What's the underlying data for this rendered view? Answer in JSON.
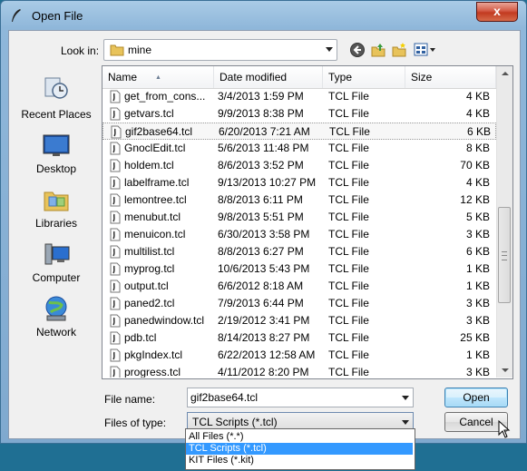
{
  "window": {
    "title": "Open File",
    "close_label": "x"
  },
  "toolbar": {
    "look_in_label": "Look in:",
    "look_in_value": "mine"
  },
  "places": [
    {
      "label": "Recent Places",
      "icon": "recent-places-icon"
    },
    {
      "label": "Desktop",
      "icon": "desktop-icon"
    },
    {
      "label": "Libraries",
      "icon": "libraries-icon"
    },
    {
      "label": "Computer",
      "icon": "computer-icon"
    },
    {
      "label": "Network",
      "icon": "network-icon"
    }
  ],
  "columns": {
    "name": "Name",
    "date": "Date modified",
    "type": "Type",
    "size": "Size"
  },
  "files": [
    {
      "name": "get_from_cons...",
      "date": "3/4/2013 1:59 PM",
      "type": "TCL File",
      "size": "4 KB"
    },
    {
      "name": "getvars.tcl",
      "date": "9/9/2013 8:38 PM",
      "type": "TCL File",
      "size": "4 KB"
    },
    {
      "name": "gif2base64.tcl",
      "date": "6/20/2013 7:21 AM",
      "type": "TCL File",
      "size": "6 KB",
      "selected": true
    },
    {
      "name": "GnoclEdit.tcl",
      "date": "5/6/2013 11:48 PM",
      "type": "TCL File",
      "size": "8 KB"
    },
    {
      "name": "holdem.tcl",
      "date": "8/6/2013 3:52 PM",
      "type": "TCL File",
      "size": "70 KB"
    },
    {
      "name": "labelframe.tcl",
      "date": "9/13/2013 10:27 PM",
      "type": "TCL File",
      "size": "4 KB"
    },
    {
      "name": "lemontree.tcl",
      "date": "8/8/2013 6:11 PM",
      "type": "TCL File",
      "size": "12 KB"
    },
    {
      "name": "menubut.tcl",
      "date": "9/8/2013 5:51 PM",
      "type": "TCL File",
      "size": "5 KB"
    },
    {
      "name": "menuicon.tcl",
      "date": "6/30/2013 3:58 PM",
      "type": "TCL File",
      "size": "3 KB"
    },
    {
      "name": "multilist.tcl",
      "date": "8/8/2013 6:27 PM",
      "type": "TCL File",
      "size": "6 KB"
    },
    {
      "name": "myprog.tcl",
      "date": "10/6/2013 5:43 PM",
      "type": "TCL File",
      "size": "1 KB"
    },
    {
      "name": "output.tcl",
      "date": "6/6/2012 8:18 AM",
      "type": "TCL File",
      "size": "1 KB"
    },
    {
      "name": "paned2.tcl",
      "date": "7/9/2013 6:44 PM",
      "type": "TCL File",
      "size": "3 KB"
    },
    {
      "name": "panedwindow.tcl",
      "date": "2/19/2012 3:41 PM",
      "type": "TCL File",
      "size": "3 KB"
    },
    {
      "name": "pdb.tcl",
      "date": "8/14/2013 8:27 PM",
      "type": "TCL File",
      "size": "25 KB"
    },
    {
      "name": "pkgIndex.tcl",
      "date": "6/22/2013 12:58 AM",
      "type": "TCL File",
      "size": "1 KB"
    },
    {
      "name": "progress.tcl",
      "date": "4/11/2012 8:20 PM",
      "type": "TCL File",
      "size": "3 KB"
    }
  ],
  "form": {
    "file_name_label": "File name:",
    "file_name_value": "gif2base64.tcl",
    "file_type_label": "Files of type:",
    "file_type_value": "TCL Scripts (*.tcl)",
    "open_label": "Open",
    "cancel_label": "Cancel"
  },
  "type_options": [
    {
      "label": "All Files (*.*)"
    },
    {
      "label": "TCL Scripts (*.tcl)",
      "highlighted": true
    },
    {
      "label": "KIT Files (*.kit)"
    }
  ],
  "colors": {
    "selection": "#3399ff",
    "desktop_bg": "#1f6f93"
  }
}
